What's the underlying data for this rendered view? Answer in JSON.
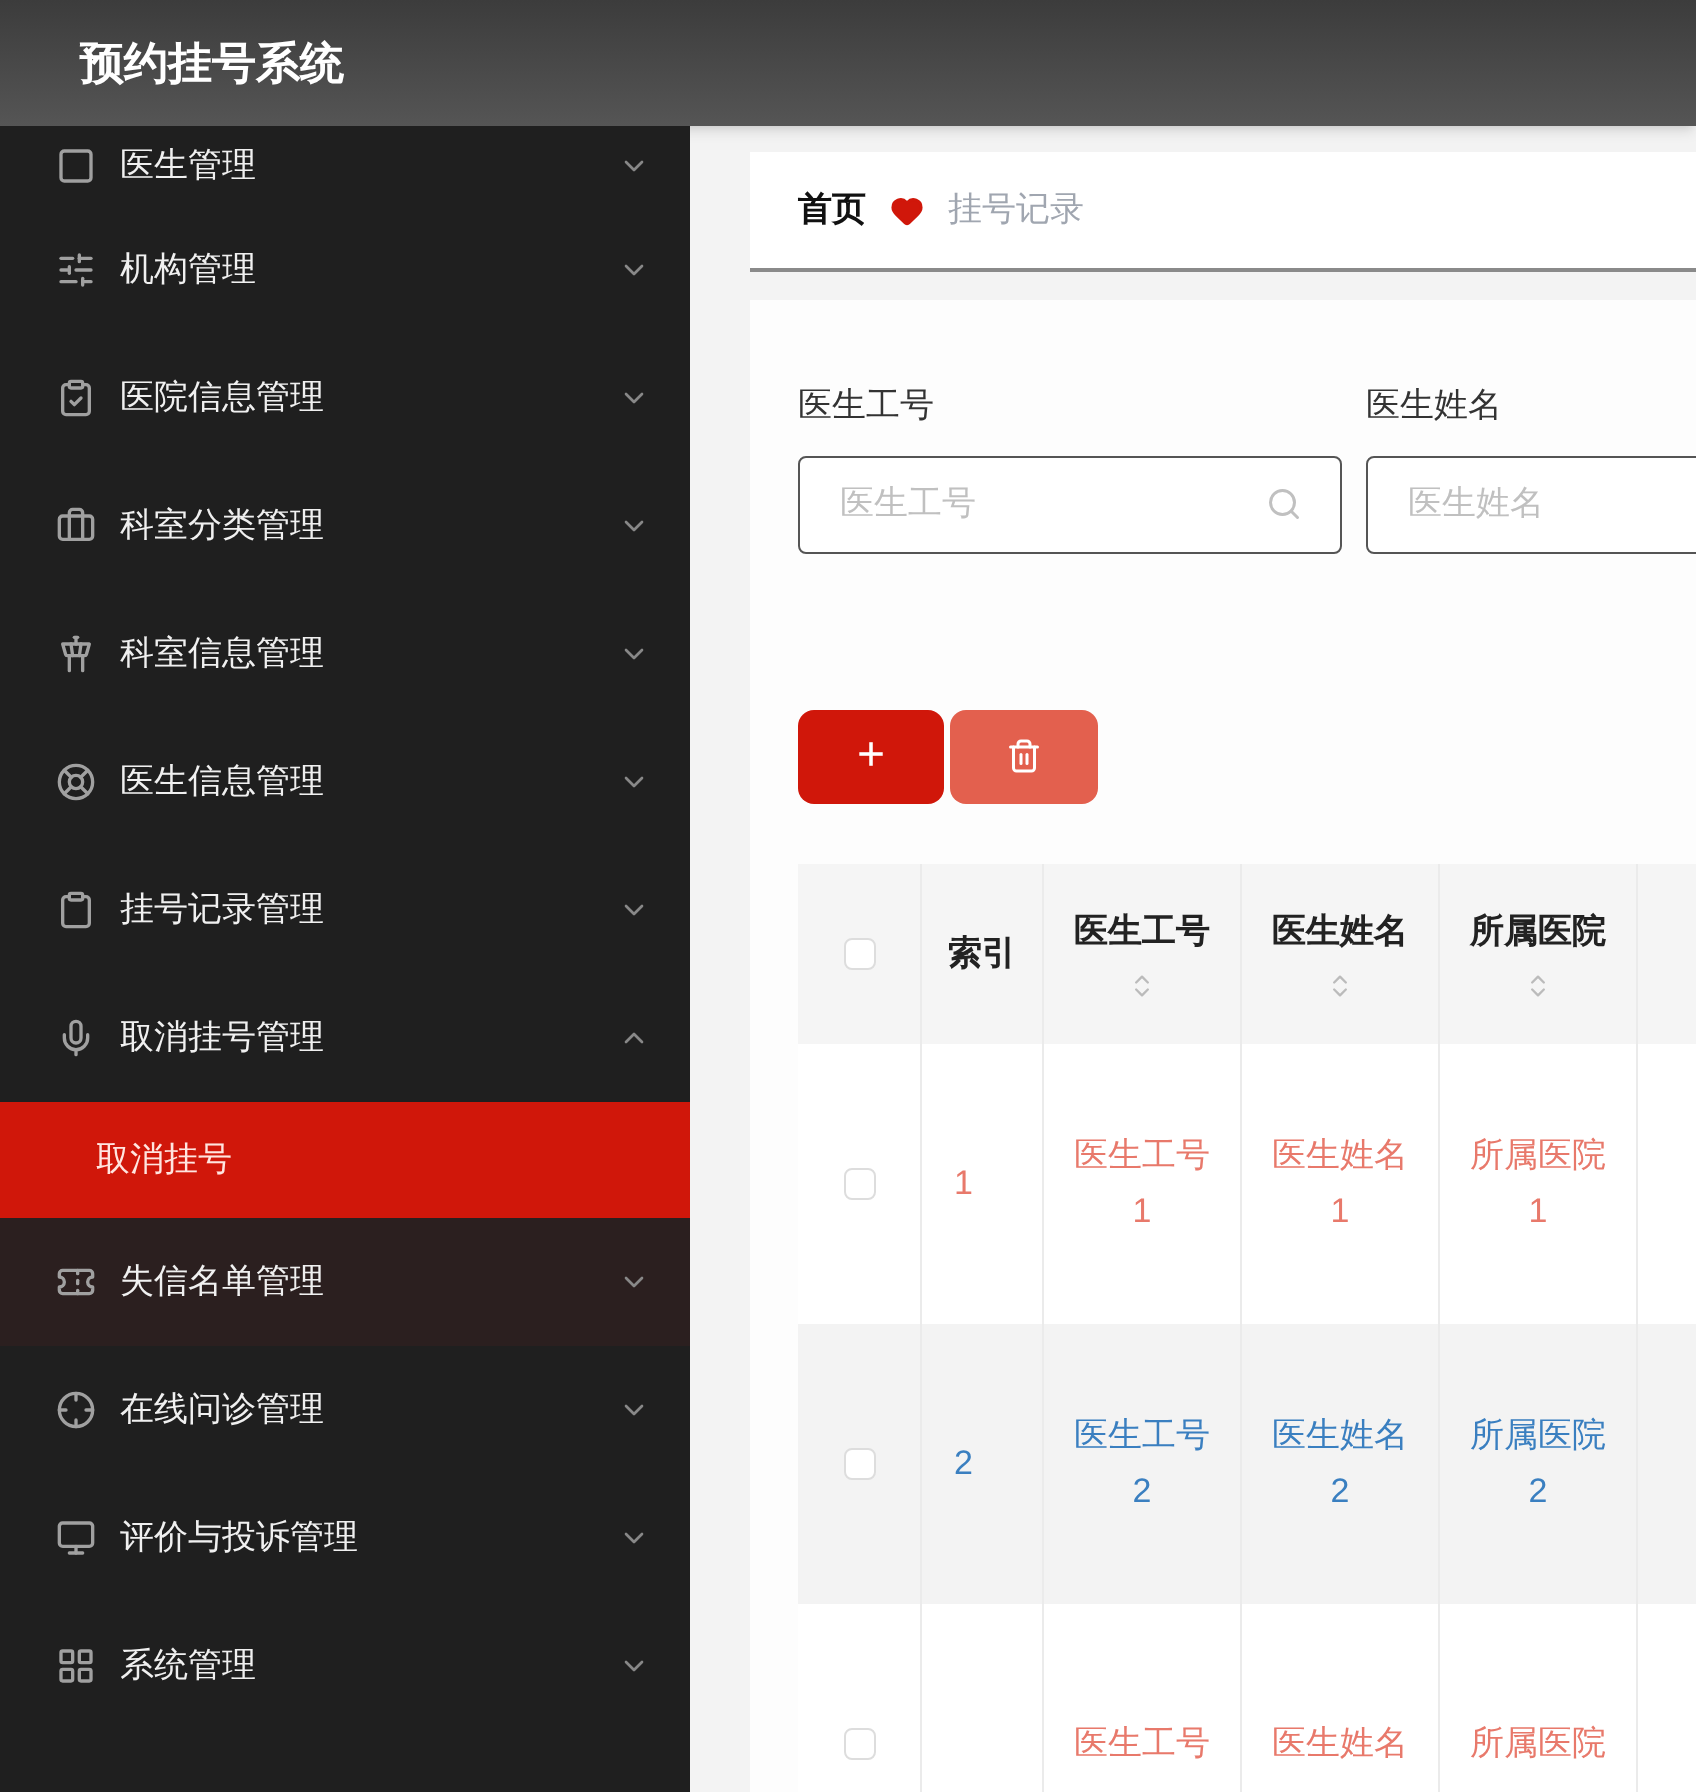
{
  "header": {
    "title": "预约挂号系统"
  },
  "sidebar": {
    "items": [
      {
        "label": "医生管理",
        "expanded": false,
        "highlighted": false
      },
      {
        "label": "机构管理",
        "expanded": false,
        "highlighted": false
      },
      {
        "label": "医院信息管理",
        "expanded": false,
        "highlighted": false
      },
      {
        "label": "科室分类管理",
        "expanded": false,
        "highlighted": false
      },
      {
        "label": "科室信息管理",
        "expanded": false,
        "highlighted": false
      },
      {
        "label": "医生信息管理",
        "expanded": false,
        "highlighted": false
      },
      {
        "label": "挂号记录管理",
        "expanded": false,
        "highlighted": false
      },
      {
        "label": "取消挂号管理",
        "expanded": true,
        "highlighted": false,
        "children": [
          {
            "label": "取消挂号",
            "selected": true
          }
        ]
      },
      {
        "label": "失信名单管理",
        "expanded": false,
        "highlighted": true
      },
      {
        "label": "在线问诊管理",
        "expanded": false,
        "highlighted": false
      },
      {
        "label": "评价与投诉管理",
        "expanded": false,
        "highlighted": false
      },
      {
        "label": "系统管理",
        "expanded": false,
        "highlighted": false
      }
    ]
  },
  "breadcrumb": {
    "home": "首页",
    "current": "挂号记录"
  },
  "search": {
    "fields": [
      {
        "kind": "search",
        "label": "医生工号",
        "placeholder": "医生工号"
      },
      {
        "kind": "text",
        "label": "医生姓名",
        "placeholder": "医生姓名"
      }
    ]
  },
  "toolbar": {
    "buttons": [
      {
        "kind": "add",
        "text": "+"
      },
      {
        "kind": "delete"
      }
    ]
  },
  "table": {
    "select_all": {
      "checked": false
    },
    "columns": [
      {
        "kind": "plain",
        "label": "索引"
      },
      {
        "kind": "sortable",
        "label": "医生工号"
      },
      {
        "kind": "sortable",
        "label": "医生姓名"
      },
      {
        "kind": "sortable",
        "label": "所属医院"
      }
    ],
    "rows": [
      {
        "checked": false,
        "color": "#e8796b",
        "cells": [
          "1",
          "医生工号\n1",
          "医生姓名\n1",
          "所属医院\n1"
        ]
      },
      {
        "checked": false,
        "color": "#3a7fc0",
        "cells": [
          "2",
          "医生工号\n2",
          "医生姓名\n2",
          "所属医院\n2"
        ]
      },
      {
        "checked": false,
        "color": "#e8796b",
        "cells": [
          "",
          "医生工号",
          "医生姓名",
          "所属医院"
        ]
      }
    ]
  }
}
